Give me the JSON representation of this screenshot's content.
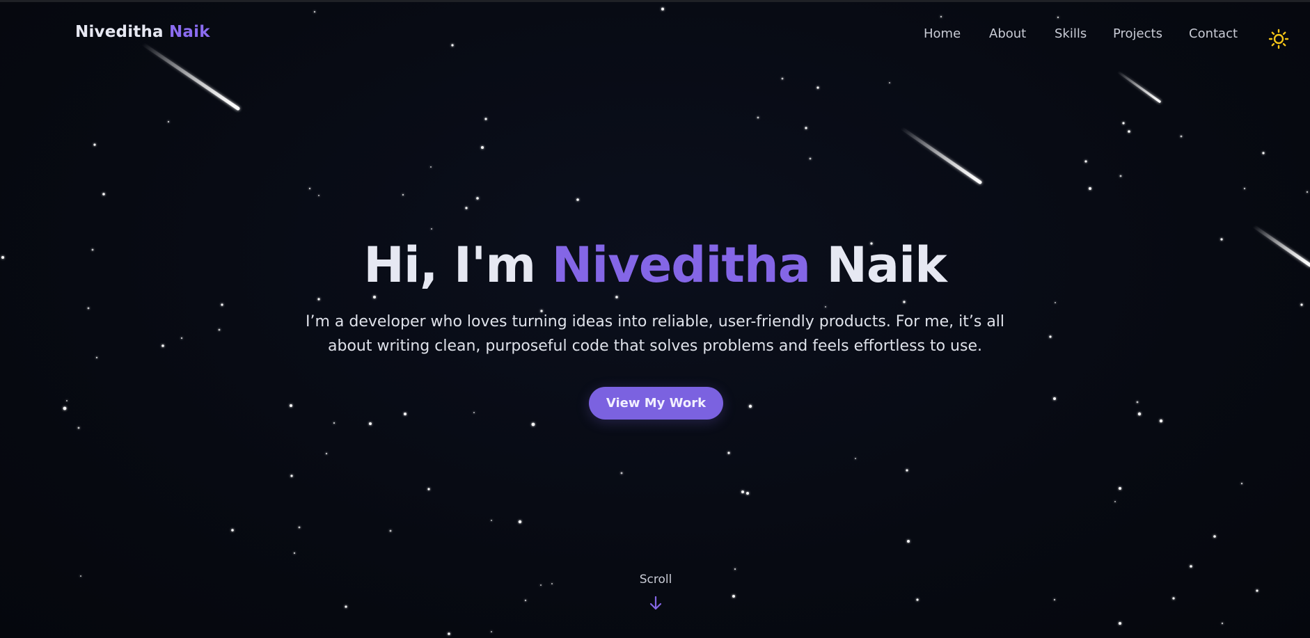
{
  "brand": {
    "first": "Niveditha",
    "last": "Naik"
  },
  "nav": {
    "items": [
      {
        "label": "Home"
      },
      {
        "label": "About"
      },
      {
        "label": "Skills"
      },
      {
        "label": "Projects"
      },
      {
        "label": "Contact"
      }
    ],
    "theme_toggle_icon": "sun-icon"
  },
  "hero": {
    "greeting": "Hi, I'm",
    "name_first": "Niveditha",
    "name_last": "Naik",
    "description_line1": "I’m a developer who loves turning ideas into reliable, user-friendly products. For me, it’s all",
    "description_line2": "about writing clean, purposeful code that solves problems and feels effortless to use.",
    "cta_label": "View My Work"
  },
  "scroll": {
    "label": "Scroll",
    "icon": "arrow-down-icon"
  },
  "colors": {
    "background": "#070a12",
    "accent": "#8466e6",
    "button": "#7b62e0",
    "text": "#e6e8f2",
    "nav_text": "#c9ccd6",
    "sun": "#f5c518"
  }
}
